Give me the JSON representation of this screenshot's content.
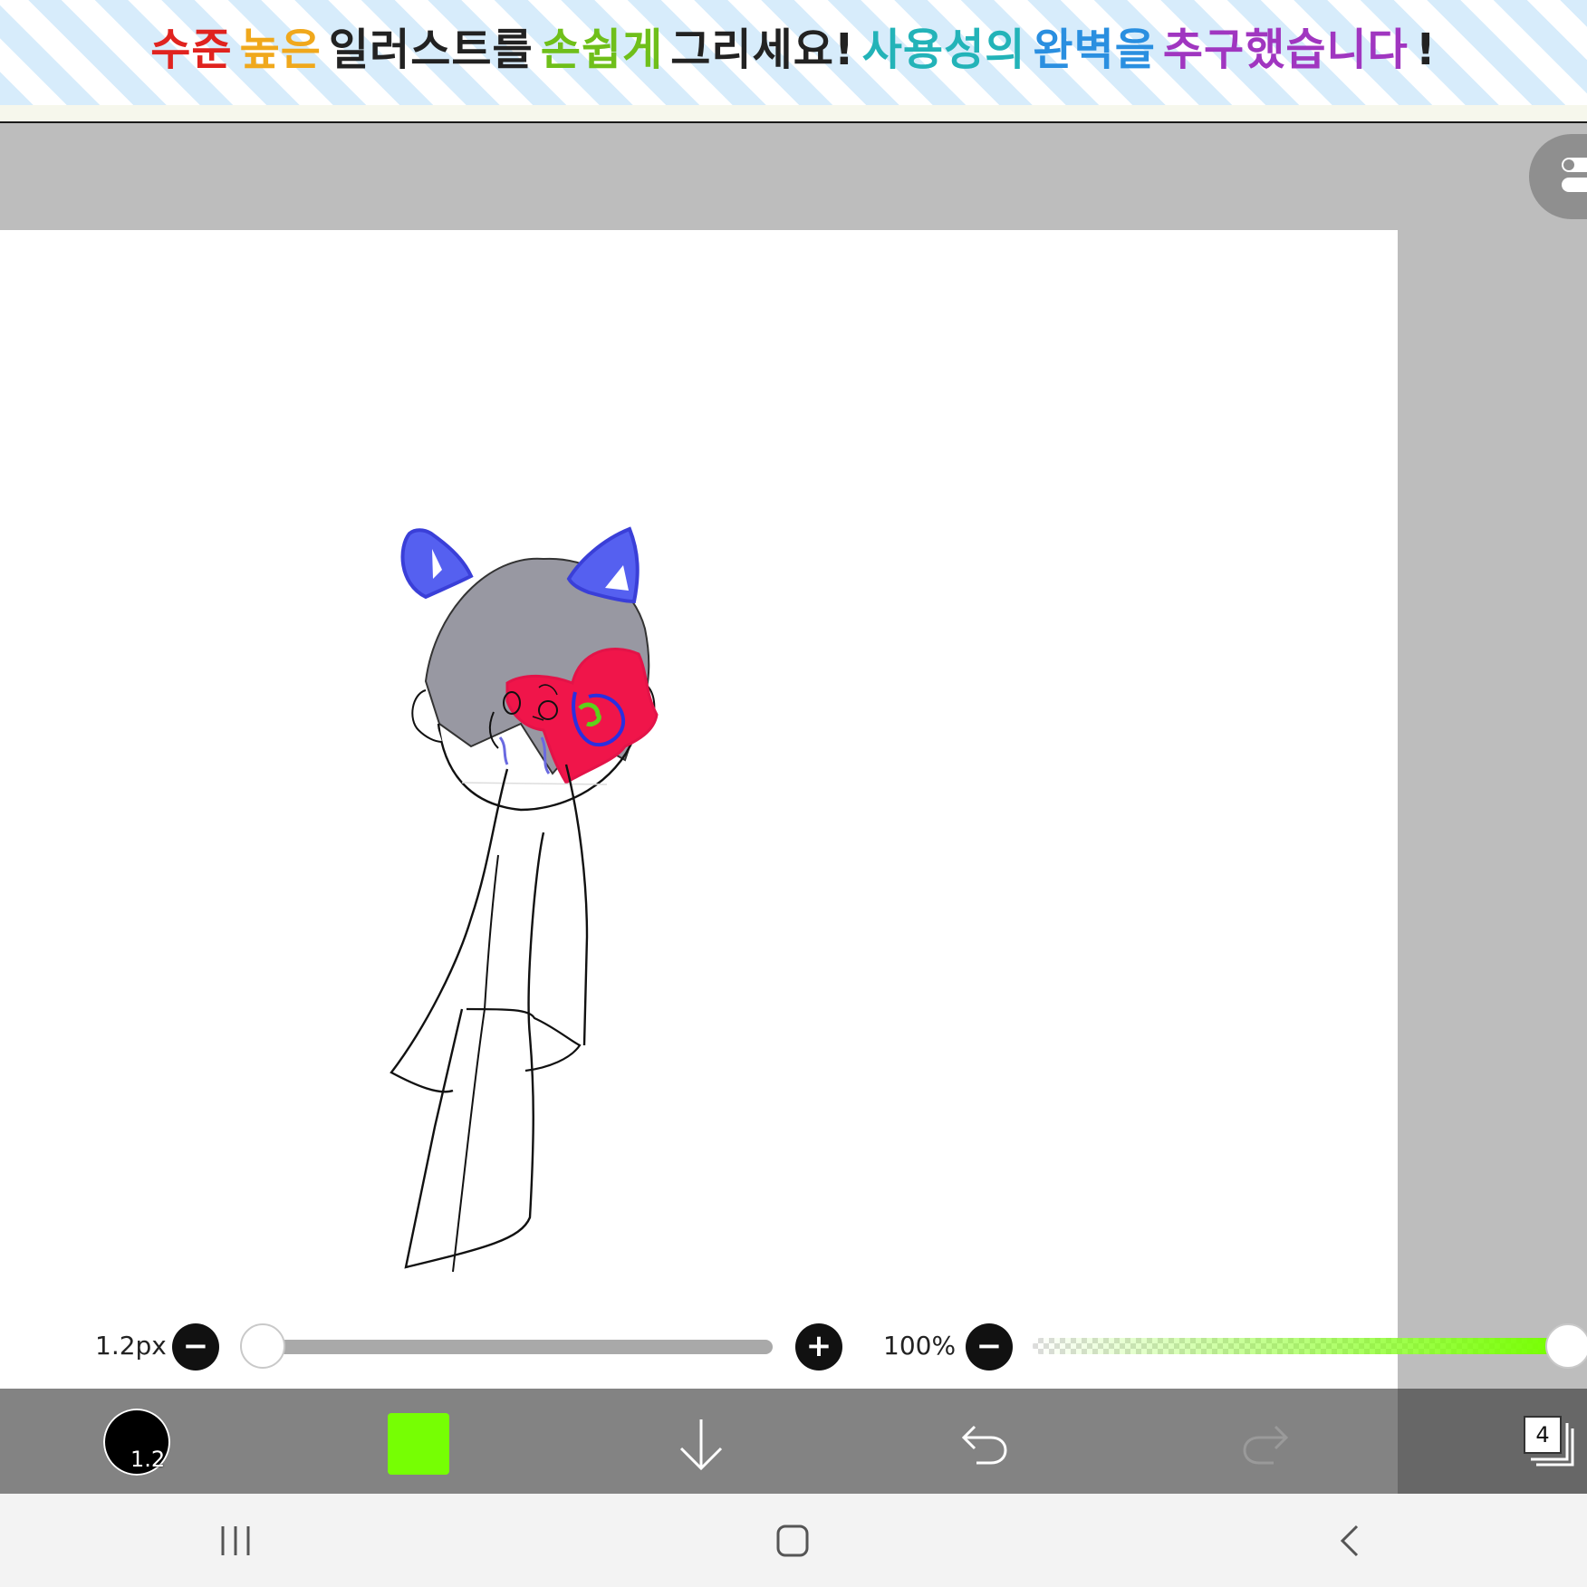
{
  "banner": {
    "segments": [
      {
        "text": "수준",
        "color": "#e0231f"
      },
      {
        "text": "높은",
        "color": "#f0a81c"
      },
      {
        "text": "일러스트를",
        "color": "#222222"
      },
      {
        "text": "손쉽게",
        "color": "#6fbf1a"
      },
      {
        "text": "그리세요!",
        "color": "#222222"
      },
      {
        "text": "사용성의",
        "color": "#23b3b8"
      },
      {
        "text": "완벽을",
        "color": "#2a8fe0"
      },
      {
        "text": "추구했습니다",
        "color": "#a036c0"
      },
      {
        "text": "!",
        "color": "#222222"
      }
    ]
  },
  "brush_size": {
    "label": "1.2px",
    "decrease_symbol": "−",
    "increase_symbol": "+",
    "value_fraction": 0.0
  },
  "opacity": {
    "label": "100%",
    "decrease_symbol": "−",
    "value_fraction": 1.0,
    "color": "#76ff03"
  },
  "toolbar": {
    "brush_size_badge": "1.2",
    "current_color": "#76ff03",
    "layer_count": "4",
    "icons": [
      "download-icon",
      "undo-icon",
      "redo-icon",
      "layers-icon"
    ]
  },
  "system_nav": {
    "icons": [
      "recent-apps-icon",
      "home-icon",
      "back-icon"
    ]
  }
}
